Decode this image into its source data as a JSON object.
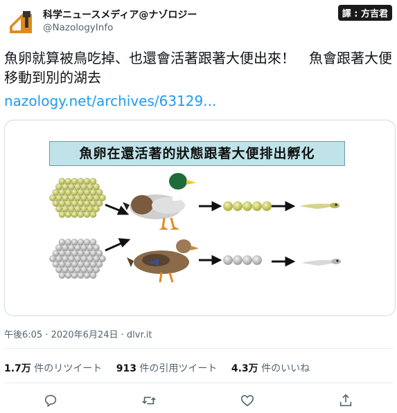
{
  "header": {
    "display_name": "科学ニュースメディア@ナゾロジー",
    "handle": "@NazologyInfo",
    "watermark": "譯 : 方吉君"
  },
  "tweet": {
    "text": "魚卵就算被鳥吃掉、也還會活著跟著大便出來！　魚會跟著大便移動到別的湖去",
    "link": "nazology.net/archives/63129..."
  },
  "figure": {
    "title": "魚卵在還活著的狀態跟著大便排出孵化"
  },
  "meta": {
    "timestamp": "午後6:05 · 2020年6月24日 · dlvr.it"
  },
  "stats": {
    "retweets_count": "1.7万",
    "retweets_label": "件のリツイート",
    "quotes_count": "913",
    "quotes_label": "件の引用ツイート",
    "likes_count": "4.3万",
    "likes_label": "件のいいね"
  },
  "actions": [
    "reply-icon",
    "retweet-icon",
    "like-icon",
    "share-icon"
  ],
  "colors": {
    "link": "#1d9bf0",
    "muted": "#536471",
    "title_bg": "#bfe3e8"
  }
}
